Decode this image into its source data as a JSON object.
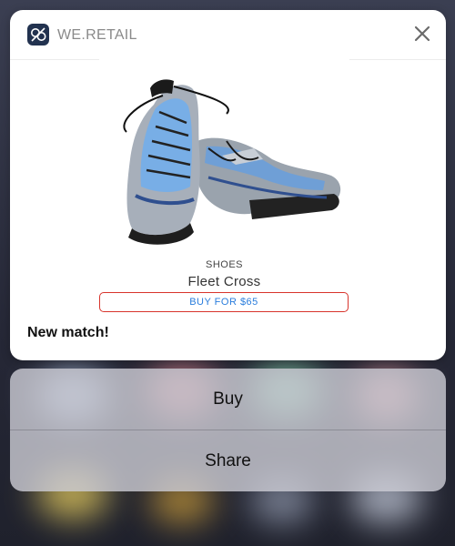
{
  "app": {
    "name": "WE.RETAIL",
    "icon": "we-retail-logo-icon"
  },
  "notification": {
    "close_icon": "close-icon",
    "product": {
      "image": "running-shoes-image",
      "category": "SHOES",
      "name": "Fleet Cross",
      "buy_label": "BUY FOR $65"
    },
    "message": "New match!"
  },
  "actions": [
    {
      "label": "Buy"
    },
    {
      "label": "Share"
    }
  ],
  "colors": {
    "card_bg": "#ffffff",
    "accent_border": "#d8342c",
    "link_blue": "#2a7ddc",
    "app_icon_bg": "#22324f"
  }
}
